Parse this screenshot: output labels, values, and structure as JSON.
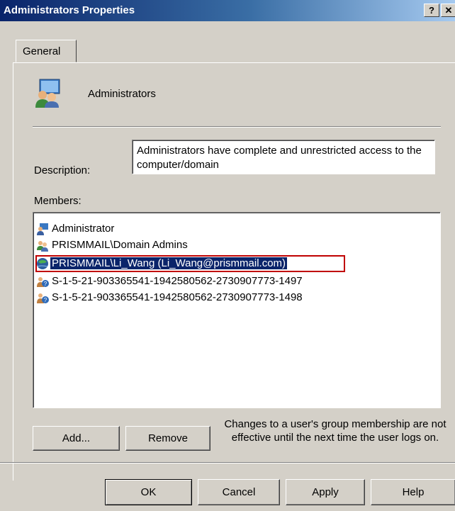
{
  "window": {
    "title": "Administrators Properties",
    "help_label": "?",
    "close_label": "✕"
  },
  "tabs": [
    {
      "label": "General",
      "selected": true
    }
  ],
  "group": {
    "name": "Administrators",
    "icon": "group-icon"
  },
  "description": {
    "label": "Description:",
    "value": "Administrators have complete and unrestricted access to the computer/domain"
  },
  "members": {
    "label": "Members:",
    "items": [
      {
        "name": "Administrator",
        "icon": "user-icon"
      },
      {
        "name": "PRISMMAIL\\Domain Admins",
        "icon": "group-icon"
      },
      {
        "name": "PRISMMAIL\\Li_Wang (Li_Wang@prismmail.com)",
        "icon": "user-icon",
        "selected": true
      },
      {
        "name": "S-1-5-21-903365541-1942580562-2730907773-1497",
        "icon": "unknown-account-icon"
      },
      {
        "name": "S-1-5-21-903365541-1942580562-2730907773-1498",
        "icon": "unknown-account-icon"
      }
    ]
  },
  "buttons": {
    "add": "Add...",
    "remove": "Remove",
    "ok": "OK",
    "cancel": "Cancel",
    "apply": "Apply",
    "help": "Help"
  },
  "note": "Changes to a user's group membership are not effective until the next time the user logs on.",
  "colors": {
    "selection": "#0a246a",
    "highlight_outline": "#c00000",
    "dialog_bg": "#d4d0c8"
  }
}
